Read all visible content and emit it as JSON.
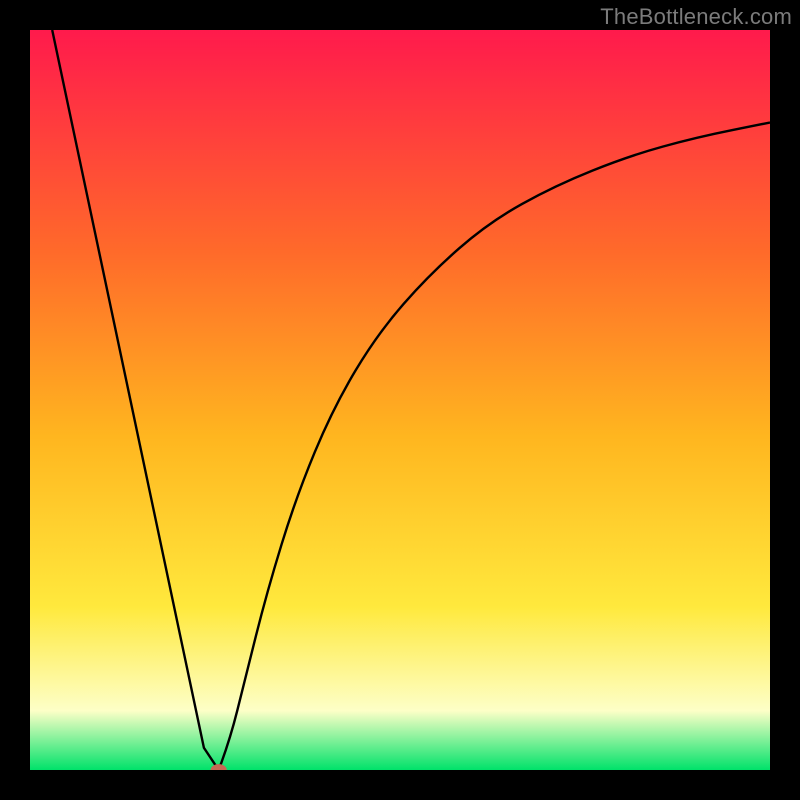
{
  "watermark": "TheBottleneck.com",
  "colors": {
    "frame_bg": "#000000",
    "gradient_top": "#ff1a4c",
    "gradient_upper_mid": "#ff6a2a",
    "gradient_mid": "#ffb61f",
    "gradient_lower_mid": "#ffe93d",
    "gradient_pale": "#fdffc7",
    "gradient_bottom": "#00e26a",
    "curve_stroke": "#000000",
    "marker_fill": "#c56a54"
  },
  "chart_data": {
    "type": "line",
    "title": "",
    "xlabel": "",
    "ylabel": "",
    "xlim": [
      0,
      100
    ],
    "ylim": [
      0,
      100
    ],
    "grid": false,
    "legend": false,
    "series": [
      {
        "name": "left-line",
        "x": [
          3,
          23.5,
          25.5
        ],
        "values": [
          100,
          3,
          0
        ]
      },
      {
        "name": "right-curve",
        "x": [
          25.5,
          27,
          29,
          32,
          36,
          41,
          47,
          54,
          62,
          71,
          81,
          90,
          100
        ],
        "values": [
          0,
          4,
          12,
          24,
          37,
          49,
          59,
          67,
          74,
          79,
          83,
          85.5,
          87.5
        ]
      }
    ],
    "marker": {
      "x": 25.5,
      "y": 0,
      "rx": 1.1,
      "ry": 0.8
    },
    "gradient_stops": [
      {
        "offset": 0.0,
        "color_key": "gradient_top"
      },
      {
        "offset": 0.3,
        "color_key": "gradient_upper_mid"
      },
      {
        "offset": 0.55,
        "color_key": "gradient_mid"
      },
      {
        "offset": 0.78,
        "color_key": "gradient_lower_mid"
      },
      {
        "offset": 0.92,
        "color_key": "gradient_pale"
      },
      {
        "offset": 1.0,
        "color_key": "gradient_bottom"
      }
    ]
  }
}
